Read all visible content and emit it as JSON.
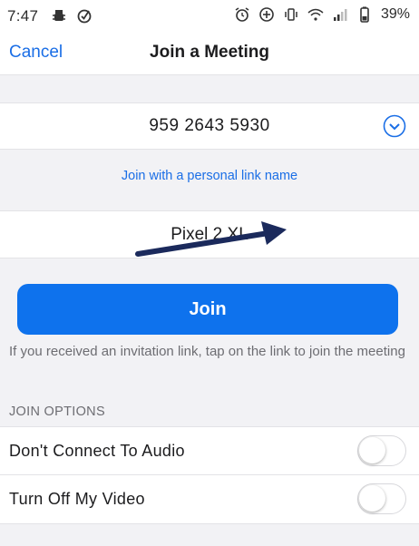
{
  "status_bar": {
    "time": "7:47",
    "battery": "39%",
    "left_icons": [
      "notification-bug-icon",
      "check-badge-icon"
    ],
    "right_icons": [
      "alarm-icon",
      "data-saver-icon",
      "vibrate-icon",
      "wifi-icon",
      "signal-icon",
      "battery-icon"
    ]
  },
  "nav": {
    "cancel_label": "Cancel",
    "title": "Join a Meeting"
  },
  "meeting": {
    "id_value": "959 2643 5930",
    "history_icon": "chevron-down-circle-icon"
  },
  "personal_link_label": "Join with a personal link name",
  "name_field": {
    "value": "Pixel 2 XL"
  },
  "join_button_label": "Join",
  "hint_text": "If you received an invitation link, tap on the link to join the meeting",
  "join_options": {
    "section_title": "JOIN OPTIONS",
    "options": [
      {
        "label": "Don't Connect To Audio",
        "enabled": false
      },
      {
        "label": "Turn Off My Video",
        "enabled": false
      }
    ]
  },
  "colors": {
    "accent": "#0e72ed",
    "link": "#1a6ee6",
    "background": "#f2f2f5",
    "annotation_arrow": "#1b2a5c"
  }
}
